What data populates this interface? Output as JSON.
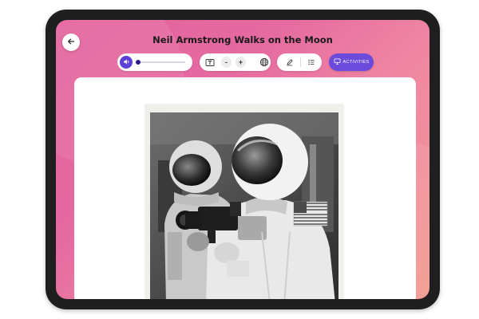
{
  "header": {
    "title": "Neil Armstrong Walks on the Moon",
    "back_icon": "arrow-left-icon"
  },
  "toolbar": {
    "audio": {
      "icon": "speaker-icon",
      "progress": 0.0
    },
    "text_tools": {
      "font_icon": "text-size-icon",
      "decrease_label": "-",
      "increase_label": "+",
      "language_icon": "globe-icon"
    },
    "edit_tools": {
      "highlight_icon": "pencil-icon",
      "list_icon": "list-icon"
    },
    "activities_label": "ACTIVITIES",
    "activities_icon": "presentation-icon"
  },
  "colors": {
    "accent": "#6a4bdc",
    "audio_button": "#5b3fd6",
    "background_gradient_start": "#e4629d",
    "background_gradient_end": "#f29a8f",
    "device_frame": "#1f1f1f"
  }
}
